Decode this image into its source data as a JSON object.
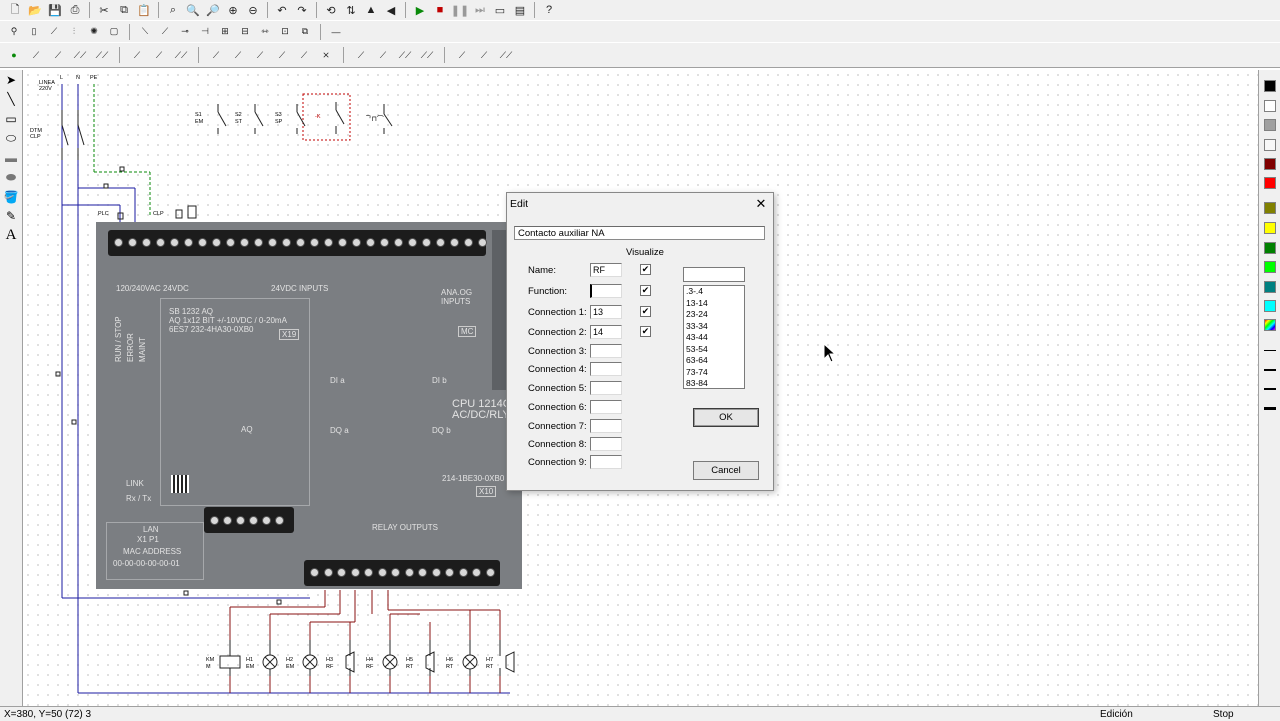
{
  "toolbar1": {
    "icons": [
      "new-file",
      "open-folder",
      "save",
      "print",
      "cut",
      "copy",
      "paste",
      "zoom-page",
      "zoom-in",
      "zoom-out",
      "zoom-fit",
      "zoom-window",
      "undo",
      "redo",
      "rotate",
      "flip-vertical",
      "flip-horizontal",
      "mirror",
      "play",
      "stop",
      "pause",
      "step-end",
      "window-tile",
      "properties",
      "help"
    ]
  },
  "toolbar2": {
    "icons": [
      "lamp",
      "fuse",
      "switch",
      "motor-3ph",
      "coil-star",
      "relay-box",
      "contact-no",
      "contact-nc",
      "node",
      "resistor",
      "transistor",
      "diode",
      "capacitor",
      "sensor",
      "terminal-block",
      "wire"
    ]
  },
  "toolbar3": {
    "icons": [
      "dot-node",
      "contact-1",
      "contact-2",
      "contact-3",
      "contact-4",
      "contact-5",
      "contact-6",
      "contact-7",
      "contact-8",
      "contact-9",
      "contact-10",
      "contact-11",
      "contact-12",
      "contact-13",
      "contact-14",
      "contact-15",
      "contact-16",
      "contact-17",
      "contact-18",
      "contact-19",
      "contact-20"
    ]
  },
  "left_tools": [
    "select-arrow",
    "line",
    "rectangle",
    "ellipse",
    "filled-rectangle",
    "filled-ellipse",
    "fill-bucket",
    "pen",
    "text"
  ],
  "palette_colors": [
    "#000000",
    "#ffffff",
    "#a0a0a0",
    "#f8f8f8",
    "#800000",
    "#ff0000",
    "#808000",
    "#ffff00",
    "#008000",
    "#00ff00",
    "#008080",
    "#00ffff",
    "rainbow"
  ],
  "schematic": {
    "top_labels": {
      "line": "LINEA\n220V",
      "l": "L",
      "n": "N",
      "pe": "PE"
    },
    "switch_label": "DTM\nCLP",
    "contacts": [
      {
        "ref": "S1",
        "name": "EM",
        "pins": [
          "11",
          "12"
        ]
      },
      {
        "ref": "S2",
        "name": "ST",
        "pins": [
          "13",
          "14"
        ]
      },
      {
        "ref": "S3",
        "name": "SP",
        "pins": [
          "21",
          "22"
        ]
      },
      {
        "ref": "-K",
        "name": "",
        "pins": [
          "13",
          "14"
        ]
      },
      {
        "ref": "",
        "name": "",
        "pins": [
          "95",
          "96"
        ]
      }
    ],
    "plc_labels": {
      "plc": "PLC",
      "clp": "CLP"
    },
    "outputs": [
      {
        "ref": "KM",
        "name": "M"
      },
      {
        "ref": "H1",
        "name": "EM"
      },
      {
        "ref": "H2",
        "name": "EM"
      },
      {
        "ref": "H3",
        "name": "RF"
      },
      {
        "ref": "H4",
        "name": "RF"
      },
      {
        "ref": "H5",
        "name": "RT"
      },
      {
        "ref": "H6",
        "name": "RT"
      },
      {
        "ref": "H7",
        "name": "RT"
      }
    ]
  },
  "plc": {
    "supply_label": "120/240VAC  24VDC",
    "di_label": "24VDC INPUTS",
    "ai_label": "ANA.OG INPUTS",
    "module_lines": [
      "SB 1232 AQ",
      "AQ 1x12 BIT +/-10VDC / 0-20mA",
      "6ES7 232-4HA30-0XB0"
    ],
    "module_x": "X19",
    "mc_label": "MC",
    "status_leds": [
      "RUN / STOP",
      "ERROR",
      "MAINT"
    ],
    "di_a": "DI a",
    "di_b": "DI b",
    "dq_a": "DQ a",
    "dq_b": "DQ b",
    "cpu_name": "CPU 1214C",
    "cpu_type": "AC/DC/RLY",
    "order_no": "214-1BE30-0XB0",
    "x10": "X10",
    "ao_label": "AQ",
    "link_leds": [
      "LINK",
      "Rx / Tx"
    ],
    "lan_lines": [
      "LAN",
      "X1  P1",
      "MAC ADDRESS",
      "00-00-00-00-00-01"
    ],
    "relay_label": "RELAY OUTPUTS"
  },
  "dialog": {
    "title": "Edit",
    "description": "Contacto auxiliar NA",
    "visualize_label": "Visualize",
    "fields": [
      {
        "label": "Name:",
        "value": "RF",
        "checked": true
      },
      {
        "label": "Function:",
        "value": "",
        "checked": true
      },
      {
        "label": "Connection 1:",
        "value": "13",
        "checked": true
      },
      {
        "label": "Connection 2:",
        "value": "14",
        "checked": true
      },
      {
        "label": "Connection 3:",
        "value": ""
      },
      {
        "label": "Connection 4:",
        "value": ""
      },
      {
        "label": "Connection 5:",
        "value": ""
      },
      {
        "label": "Connection 6:",
        "value": ""
      },
      {
        "label": "Connection 7:",
        "value": ""
      },
      {
        "label": "Connection 8:",
        "value": ""
      },
      {
        "label": "Connection 9:",
        "value": ""
      }
    ],
    "list_input_value": "",
    "list_items": [
      ".3-.4",
      "13-14",
      "23-24",
      "33-34",
      "43-44",
      "53-54",
      "63-64",
      "73-74",
      "83-84"
    ],
    "ok_label": "OK",
    "cancel_label": "Cancel"
  },
  "status": {
    "coords": "X=380, Y=50 (72) 3",
    "mode": "Edición",
    "state": "Stop"
  }
}
